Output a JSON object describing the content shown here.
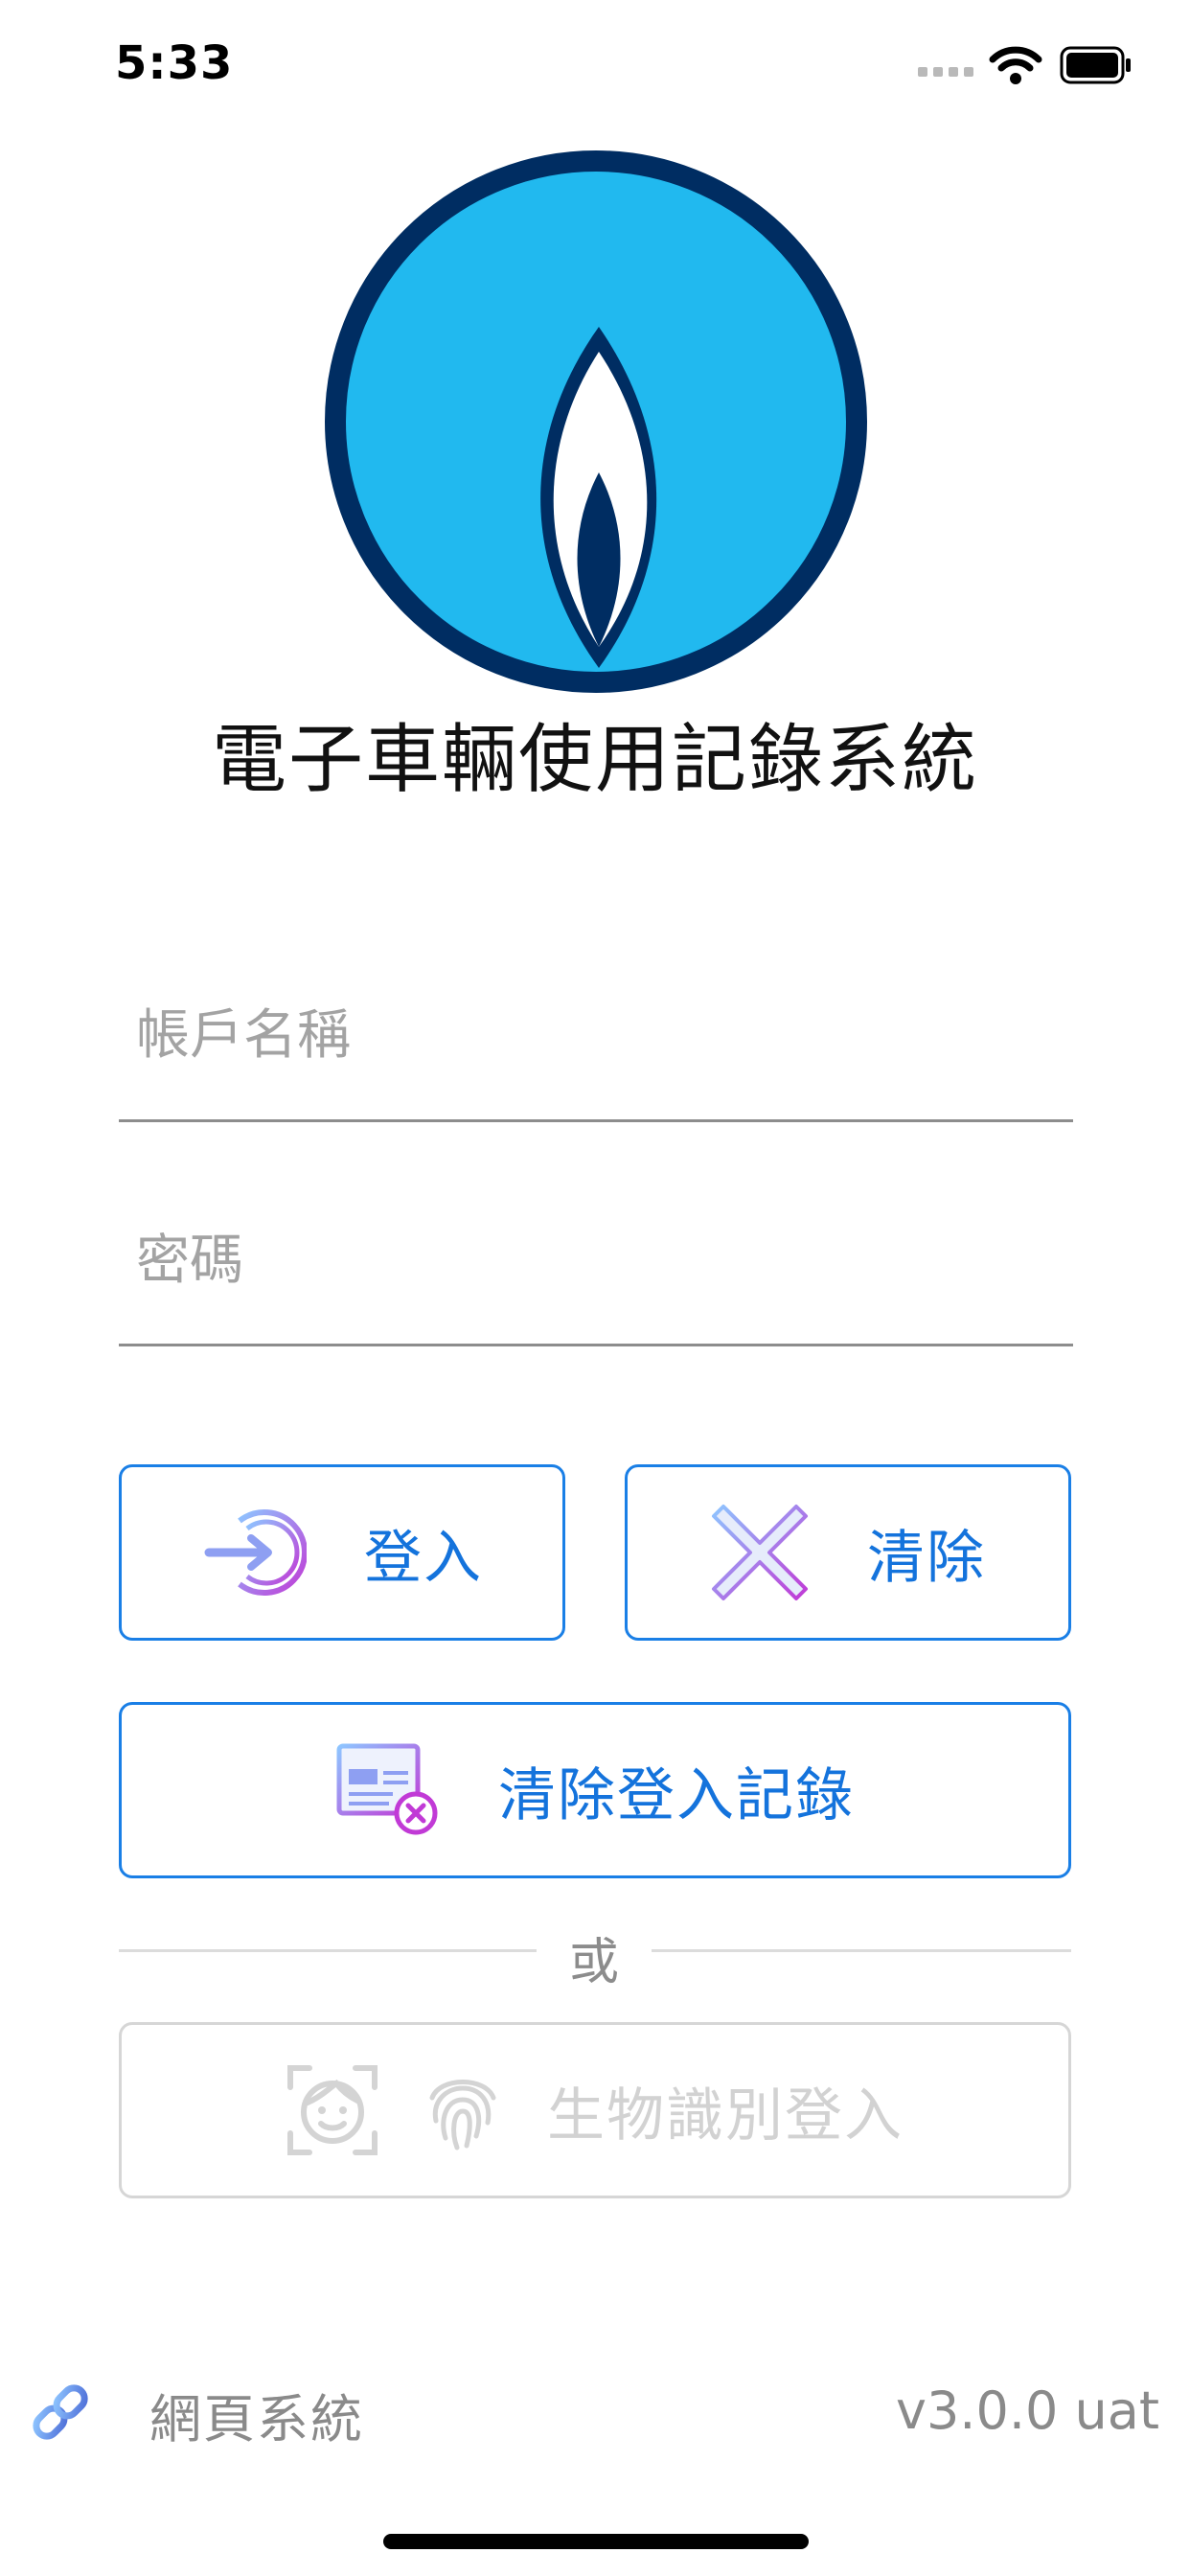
{
  "status_bar": {
    "time": "5:33"
  },
  "app": {
    "title": "電子車輛使用記錄系統"
  },
  "form": {
    "username_placeholder": "帳戶名稱",
    "password_placeholder": "密碼"
  },
  "buttons": {
    "login": "登入",
    "clear": "清除",
    "clear_history": "清除登入記錄",
    "biometric": "生物識別登入"
  },
  "divider": {
    "or": "或"
  },
  "footer": {
    "web_system": "網頁系統",
    "version": "v3.0.0 uat"
  },
  "colors": {
    "accent": "#1473dc",
    "logo_blue": "#21b9ef",
    "logo_navy": "#002d62",
    "icon_gradient_start": "#8ec5ff",
    "icon_gradient_end": "#c13ad6"
  },
  "icons": {
    "login": "login-arrow-icon",
    "clear": "x-icon",
    "clear_history": "browser-clear-icon",
    "face": "face-id-icon",
    "fingerprint": "fingerprint-icon",
    "link": "link-icon"
  }
}
